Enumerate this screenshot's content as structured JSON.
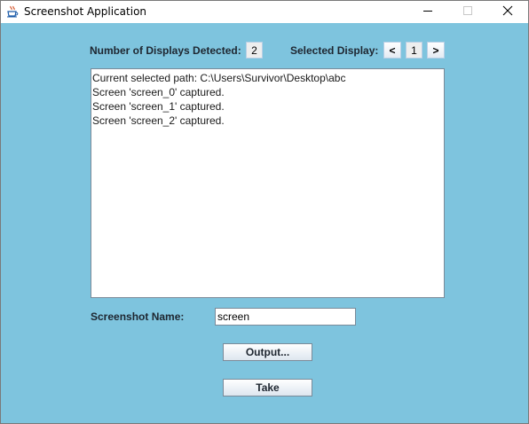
{
  "window": {
    "title": "Screenshot Application",
    "icon": "java-cup-icon",
    "controls": {
      "minimize_icon": "minimize-icon",
      "maximize_icon": "maximize-icon",
      "close_icon": "close-icon"
    },
    "background_color": "#7ec4de"
  },
  "displays": {
    "detected_label": "Number of Displays Detected:",
    "detected_count": "2",
    "selected_label": "Selected Display:",
    "prev_label": "<",
    "selected_value": "1",
    "next_label": ">"
  },
  "log": {
    "lines": [
      "Current selected path: C:\\Users\\Survivor\\Desktop\\abc",
      "Screen 'screen_0' captured.",
      "Screen 'screen_1' captured.",
      "Screen 'screen_2' captured."
    ]
  },
  "screenshot_name": {
    "label": "Screenshot Name:",
    "value": "screen"
  },
  "buttons": {
    "output_label": "Output...",
    "take_label": "Take"
  }
}
